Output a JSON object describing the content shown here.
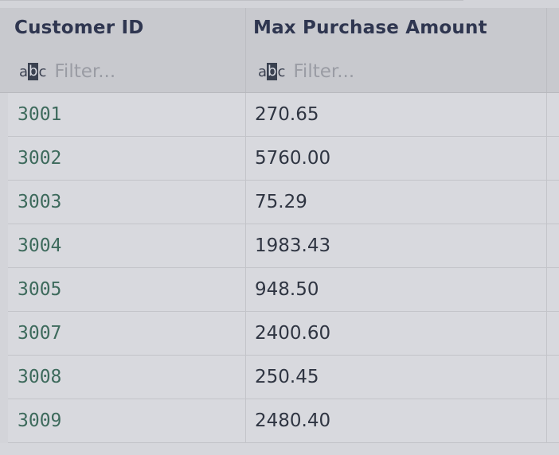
{
  "columns": [
    {
      "title": "Customer ID",
      "filter_placeholder": "Filter...",
      "type_icon": "abc-text-type-icon"
    },
    {
      "title": "Max Purchase Amount",
      "filter_placeholder": "Filter...",
      "type_icon": "abc-text-type-icon"
    }
  ],
  "type_icon_text": {
    "pre": "a",
    "mid": "b",
    "post": "c"
  },
  "rows": [
    {
      "customer_id": "3001",
      "max_purchase_amount": "270.65"
    },
    {
      "customer_id": "3002",
      "max_purchase_amount": "5760.00"
    },
    {
      "customer_id": "3003",
      "max_purchase_amount": "75.29"
    },
    {
      "customer_id": "3004",
      "max_purchase_amount": "1983.43"
    },
    {
      "customer_id": "3005",
      "max_purchase_amount": "948.50"
    },
    {
      "customer_id": "3007",
      "max_purchase_amount": "2400.60"
    },
    {
      "customer_id": "3008",
      "max_purchase_amount": "250.45"
    },
    {
      "customer_id": "3009",
      "max_purchase_amount": "2480.40"
    }
  ],
  "colors": {
    "header_bg": "#c8c9ce",
    "row_bg": "#d8d9de",
    "id_text": "#3d6a5c",
    "header_text": "#2f3650"
  }
}
